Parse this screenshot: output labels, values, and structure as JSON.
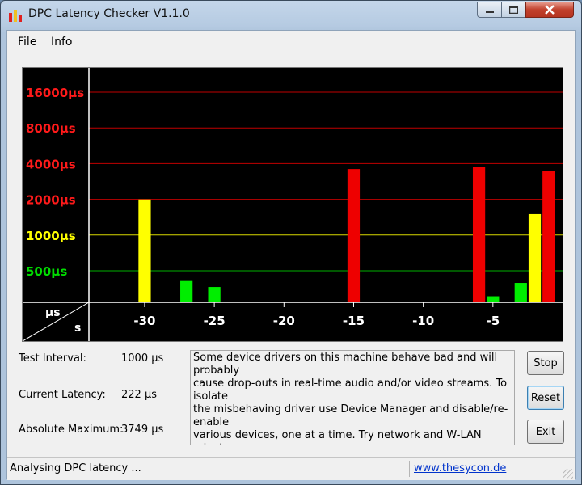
{
  "window": {
    "title": "DPC Latency Checker V1.1.0"
  },
  "menu": {
    "file": "File",
    "info": "Info"
  },
  "chart_data": {
    "type": "bar",
    "title": "",
    "y_scale": "log2",
    "y_ticks": [
      {
        "value": 500,
        "label": "500µs",
        "color": "#00dd00"
      },
      {
        "value": 1000,
        "label": "1000µs",
        "color": "#ffff00"
      },
      {
        "value": 2000,
        "label": "2000µs",
        "color": "#ff1a1a"
      },
      {
        "value": 4000,
        "label": "4000µs",
        "color": "#ff1a1a"
      },
      {
        "value": 8000,
        "label": "8000µs",
        "color": "#ff1a1a"
      },
      {
        "value": 16000,
        "label": "16000µs",
        "color": "#ff1a1a"
      }
    ],
    "x_tick_labels": [
      "-30",
      "-25",
      "-20",
      "-15",
      "-10",
      "-5"
    ],
    "x_tick_positions": [
      -30,
      -25,
      -20,
      -15,
      -10,
      -5
    ],
    "x_range": [
      -34,
      0
    ],
    "corner_labels": {
      "unit_y": "µs",
      "unit_x": "s"
    },
    "thresholds": {
      "green_max": 1000,
      "yellow_max": 2000
    },
    "colors": {
      "green": "#00ee00",
      "yellow": "#ffff00",
      "red": "#ee0000"
    },
    "bars": [
      {
        "x": -33,
        "value": 265
      },
      {
        "x": -32,
        "value": 262
      },
      {
        "x": -31,
        "value": 225
      },
      {
        "x": -30,
        "value": 1995
      },
      {
        "x": -29,
        "value": 210
      },
      {
        "x": -28,
        "value": 215
      },
      {
        "x": -27,
        "value": 410
      },
      {
        "x": -26,
        "value": 260
      },
      {
        "x": -25,
        "value": 365
      },
      {
        "x": -24,
        "value": 230
      },
      {
        "x": -23,
        "value": 215
      },
      {
        "x": -22,
        "value": 210
      },
      {
        "x": -21,
        "value": 260
      },
      {
        "x": -20,
        "value": 215
      },
      {
        "x": -19,
        "value": 225
      },
      {
        "x": -18,
        "value": 220
      },
      {
        "x": -17,
        "value": 210
      },
      {
        "x": -16,
        "value": 210
      },
      {
        "x": -15,
        "value": 3600
      },
      {
        "x": -14,
        "value": 240
      },
      {
        "x": -13,
        "value": 220
      },
      {
        "x": -12,
        "value": 210
      },
      {
        "x": -11,
        "value": 215
      },
      {
        "x": -10,
        "value": 220
      },
      {
        "x": -9,
        "value": 210
      },
      {
        "x": -8,
        "value": 225
      },
      {
        "x": -7,
        "value": 210
      },
      {
        "x": -6,
        "value": 3749
      },
      {
        "x": -5,
        "value": 305
      },
      {
        "x": -4,
        "value": 275
      },
      {
        "x": -3,
        "value": 395
      },
      {
        "x": -2,
        "value": 1500
      },
      {
        "x": -1,
        "value": 3450
      }
    ]
  },
  "stats": {
    "interval_label": "Test Interval:",
    "interval_value": "1000 µs",
    "current_label": "Current Latency:",
    "current_value": "222 µs",
    "max_label": "Absolute Maximum:",
    "max_value": "3749 µs"
  },
  "message": "Some device drivers on this machine behave bad and will probably\ncause drop-outs in real-time audio and/or video streams. To isolate\nthe misbehaving driver use Device Manager and disable/re-enable\nvarious devices, one at a time. Try network and W-LAN adapters,\nmodems, internal sound devices, USB host controllers, etc.",
  "buttons": {
    "stop": "Stop",
    "reset": "Reset",
    "exit": "Exit"
  },
  "status": {
    "text": "Analysing DPC latency ...",
    "link": "www.thesycon.de"
  }
}
